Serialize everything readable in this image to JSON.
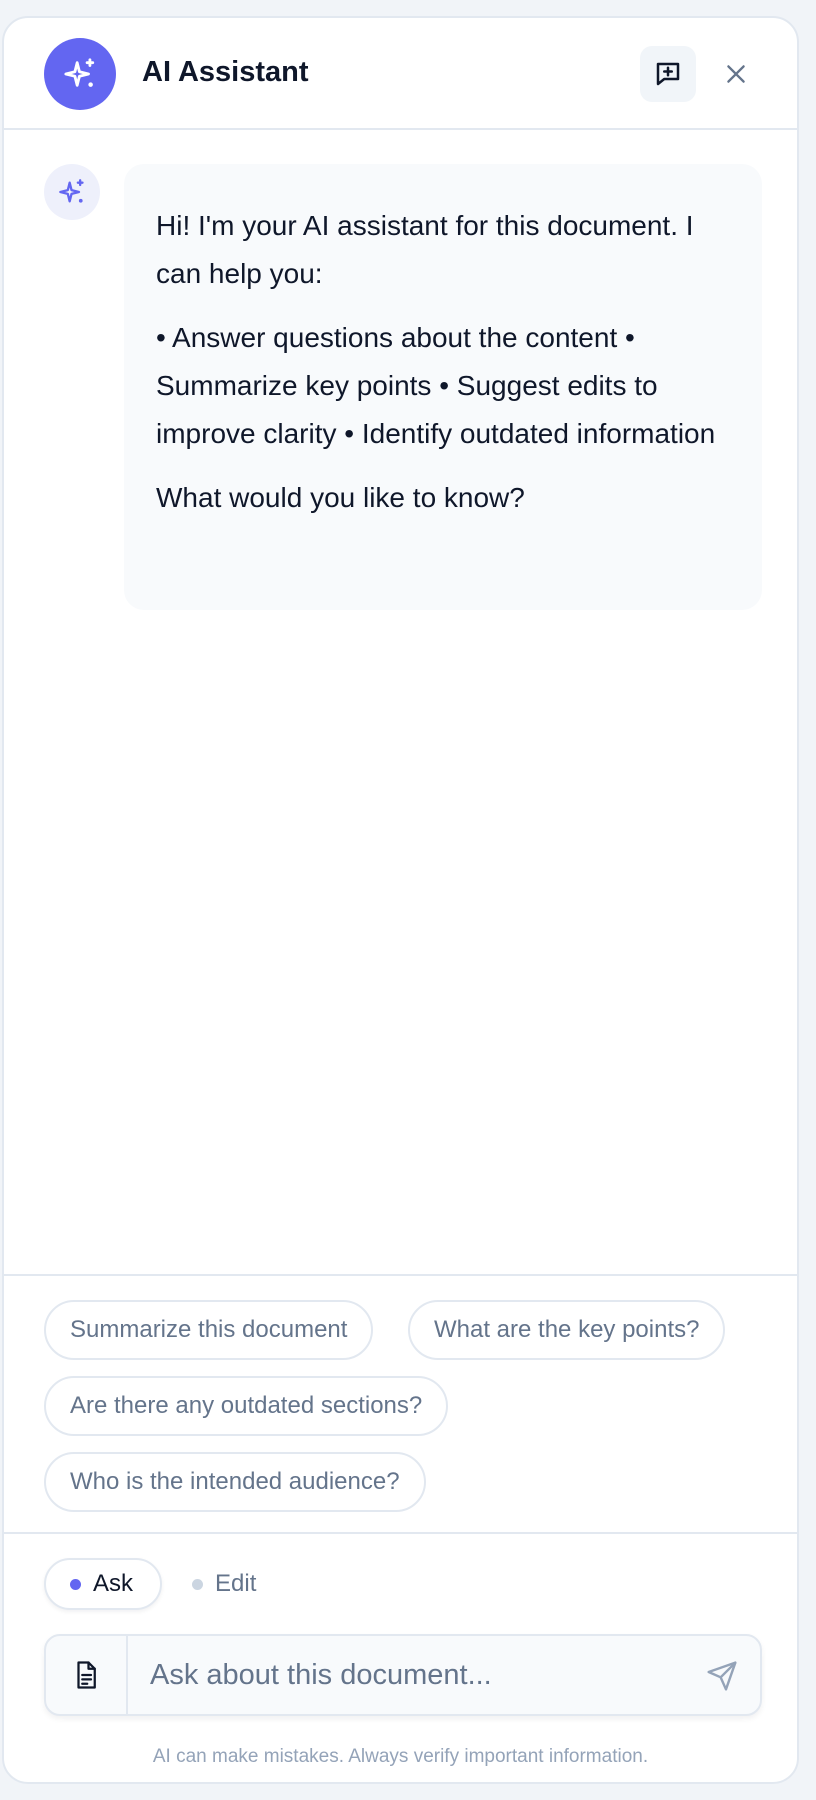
{
  "header": {
    "title": "AI Assistant",
    "icons": {
      "avatar": "sparkles-icon",
      "new_chat": "message-plus-icon",
      "close": "close-icon"
    }
  },
  "messages": [
    {
      "role": "assistant",
      "icon": "sparkles-icon",
      "paragraphs": [
        "Hi! I'm your AI assistant for this document. I can help you:",
        "• Answer questions about the content • Summarize key points • Suggest edits to improve clarity • Identify outdated information",
        "What would you like to know?"
      ]
    }
  ],
  "suggestions": [
    "Summarize this document",
    "What are the key points?",
    "Are there any outdated sections?",
    "Who is the intended audience?"
  ],
  "modes": {
    "selected": "Ask",
    "ask_label": "Ask",
    "edit_label": "Edit"
  },
  "input": {
    "placeholder": "Ask about this document...",
    "value": "",
    "icons": {
      "attach": "document-icon",
      "send": "send-icon"
    }
  },
  "disclaimer": "AI can make mistakes. Always verify important information.",
  "colors": {
    "accent": "#6366f1",
    "text": "#0f172a",
    "muted": "#64748b",
    "border": "#e2e8f0",
    "bubble_bg": "#f8fafc"
  }
}
